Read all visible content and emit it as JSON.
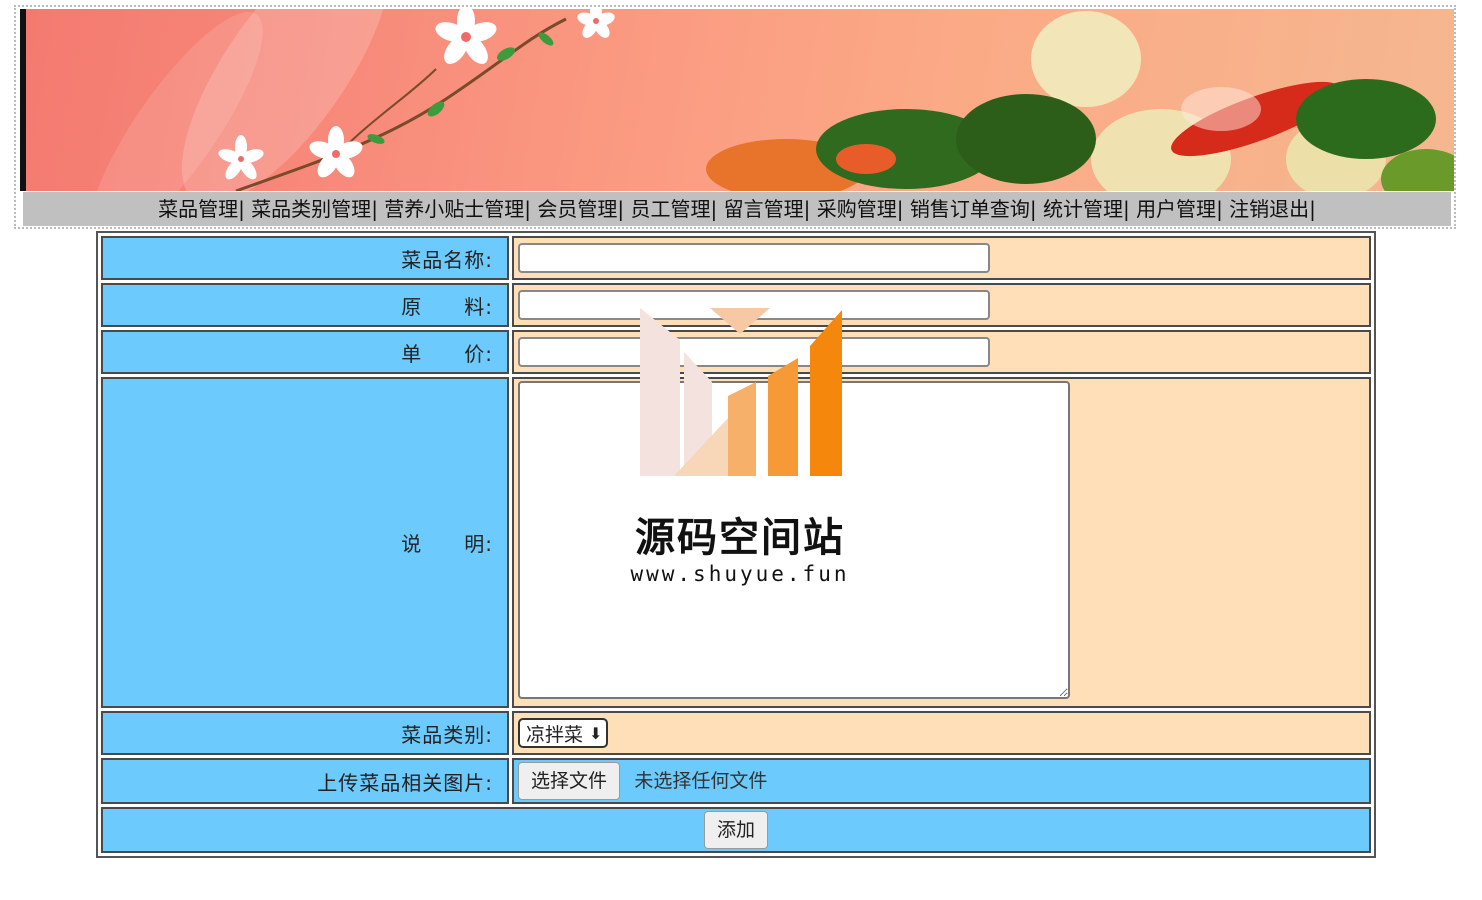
{
  "nav": {
    "items": [
      "菜品管理",
      "菜品类别管理",
      "营养小贴士管理",
      "会员管理",
      "员工管理",
      "留言管理",
      "采购管理",
      "销售订单查询",
      "统计管理",
      "用户管理",
      "注销退出"
    ],
    "separator": "|"
  },
  "form": {
    "name_label": "菜品名称:",
    "ingredients_label": "原　　料:",
    "price_label": "单　　价:",
    "description_label": "说　　明:",
    "category_label": "菜品类别:",
    "category_selected": "凉拌菜",
    "upload_label": "上传菜品相关图片:",
    "file_button": "选择文件",
    "file_status": "未选择任何文件",
    "submit_label": "添加",
    "name_value": "",
    "ingredients_value": "",
    "price_value": "",
    "description_value": ""
  },
  "watermark": {
    "title": "源码空间站",
    "url": "www.shuyue.fun"
  },
  "colors": {
    "label_bg": "#6ccafd",
    "value_bg": "#ffdfb7",
    "nav_bg": "#c0c0c0"
  }
}
